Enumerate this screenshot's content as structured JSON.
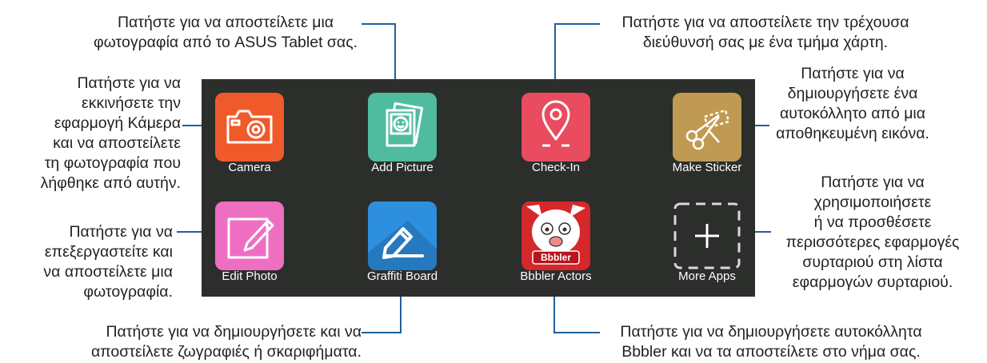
{
  "callouts": {
    "top_left": "Πατήστε για να αποστείλετε μια\nφωτογραφία από το ASUS Tablet σας.",
    "top_right": "Πατήστε για να αποστείλετε την τρέχουσα\nδιεύθυνσή σας με ένα τμήμα χάρτη.",
    "left_camera": "Πατήστε για να\nεκκινήσετε την\nεφαρμογή Κάμερα\nκαι να αποστείλετε\nτη φωτογραφία που\nλήφθηκε από αυτήν.",
    "left_edit": "Πατήστε για να\nεπεξεργαστείτε και\nνα αποστείλετε μια\nφωτογραφία.",
    "right_sticker": "Πατήστε για να\nδημιουργήσετε ένα\nαυτοκόλλητο από μια\nαποθηκευμένη εικόνα.",
    "right_more": "Πατήστε για να\nχρησιμοποιήσετε\nή να προσθέσετε\nπερισσότερες εφαρμογές\nσυρταριού στη λίστα\nεφαρμογών συρταριού.",
    "bottom_left": "Πατήστε για να δημιουργήσετε και να\nαποστείλετε ζωγραφιές ή σκαριφήματα.",
    "bottom_right": "Πατήστε για να δημιουργήσετε αυτοκόλλητα\nBbbler και να τα αποστείλετε στο νήμα σας."
  },
  "apps": [
    {
      "label": "Camera",
      "icon": "camera-icon",
      "color": "#f05a2b"
    },
    {
      "label": "Add Picture",
      "icon": "add-picture-icon",
      "color": "#4fbb9f"
    },
    {
      "label": "Check-In",
      "icon": "location-pin-icon",
      "color": "#e84c5e"
    },
    {
      "label": "Make Sticker",
      "icon": "scissors-icon",
      "color": "#c09a52"
    },
    {
      "label": "Edit Photo",
      "icon": "pencil-icon",
      "color": "#ee6fc2"
    },
    {
      "label": "Graffiti Board",
      "icon": "pen-icon",
      "color": "#2e8fde"
    },
    {
      "label": "Bbbler Actors",
      "icon": "bbbler-mascot-icon",
      "color": "#d6272b",
      "badge": "Bbbler"
    },
    {
      "label": "More Apps",
      "icon": "plus-icon",
      "color": "#2c2e2b"
    }
  ],
  "colors": {
    "leader_line": "#1f5fa0",
    "panel_bg": "#2c2e2b",
    "text": "#231f20"
  }
}
